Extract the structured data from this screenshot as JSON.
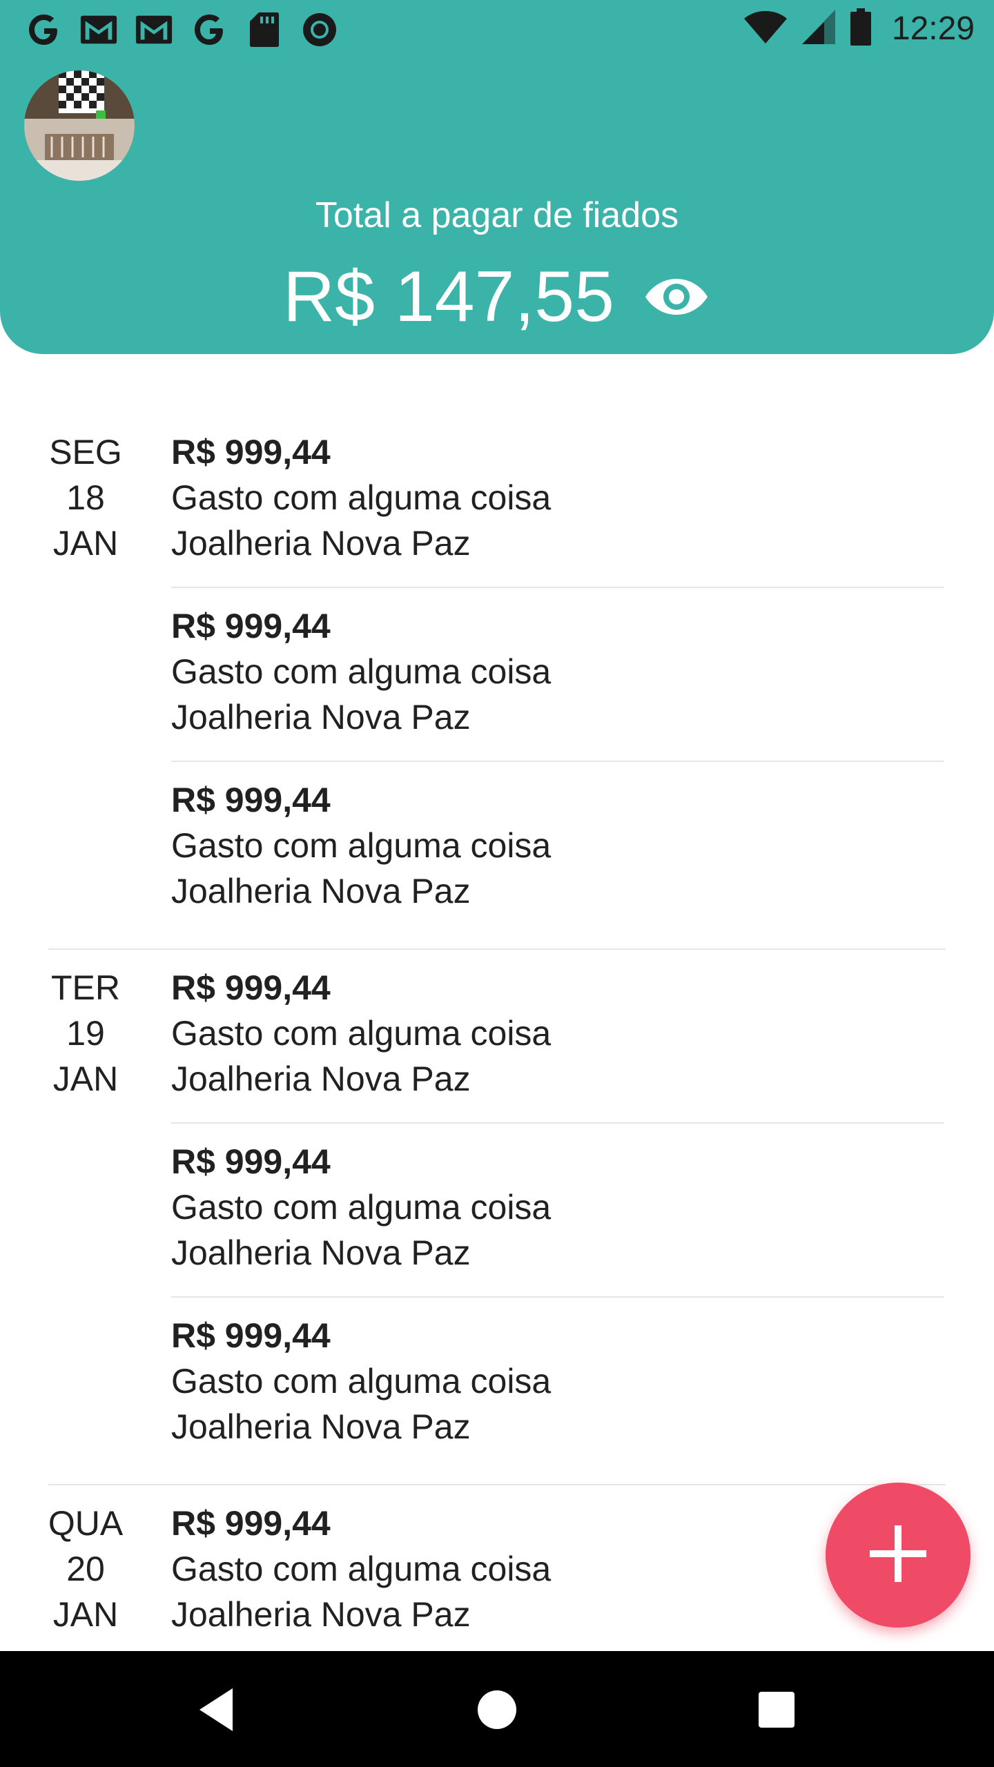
{
  "status_bar": {
    "time": "12:29",
    "left_icons": [
      "google-icon",
      "gmail-icon",
      "gmail-icon",
      "google-icon",
      "sd-card-icon",
      "circle-app-icon"
    ],
    "right_icons": [
      "wifi-icon",
      "cell-signal-icon",
      "battery-icon"
    ]
  },
  "header": {
    "total_label": "Total a pagar de fiados",
    "total_value": "R$ 147,55",
    "background": "#3bb3a9"
  },
  "groups": [
    {
      "weekday": "SEG",
      "day": "18",
      "month": "JAN",
      "entries": [
        {
          "amount": "R$ 999,44",
          "description": "Gasto com alguma coisa",
          "store": "Joalheria Nova Paz"
        },
        {
          "amount": "R$ 999,44",
          "description": "Gasto com alguma coisa",
          "store": "Joalheria Nova Paz"
        },
        {
          "amount": "R$ 999,44",
          "description": "Gasto com alguma coisa",
          "store": "Joalheria Nova Paz"
        }
      ]
    },
    {
      "weekday": "TER",
      "day": "19",
      "month": "JAN",
      "entries": [
        {
          "amount": "R$ 999,44",
          "description": "Gasto com alguma coisa",
          "store": "Joalheria Nova Paz"
        },
        {
          "amount": "R$ 999,44",
          "description": "Gasto com alguma coisa",
          "store": "Joalheria Nova Paz"
        },
        {
          "amount": "R$ 999,44",
          "description": "Gasto com alguma coisa",
          "store": "Joalheria Nova Paz"
        }
      ]
    },
    {
      "weekday": "QUA",
      "day": "20",
      "month": "JAN",
      "entries": [
        {
          "amount": "R$ 999,44",
          "description": "Gasto com alguma coisa",
          "store": "Joalheria Nova Paz"
        }
      ]
    }
  ],
  "fab": {
    "icon": "plus-icon",
    "color": "#ef4b66"
  },
  "nav_bar": {
    "icons": [
      "back-icon",
      "home-icon",
      "recents-icon"
    ]
  }
}
